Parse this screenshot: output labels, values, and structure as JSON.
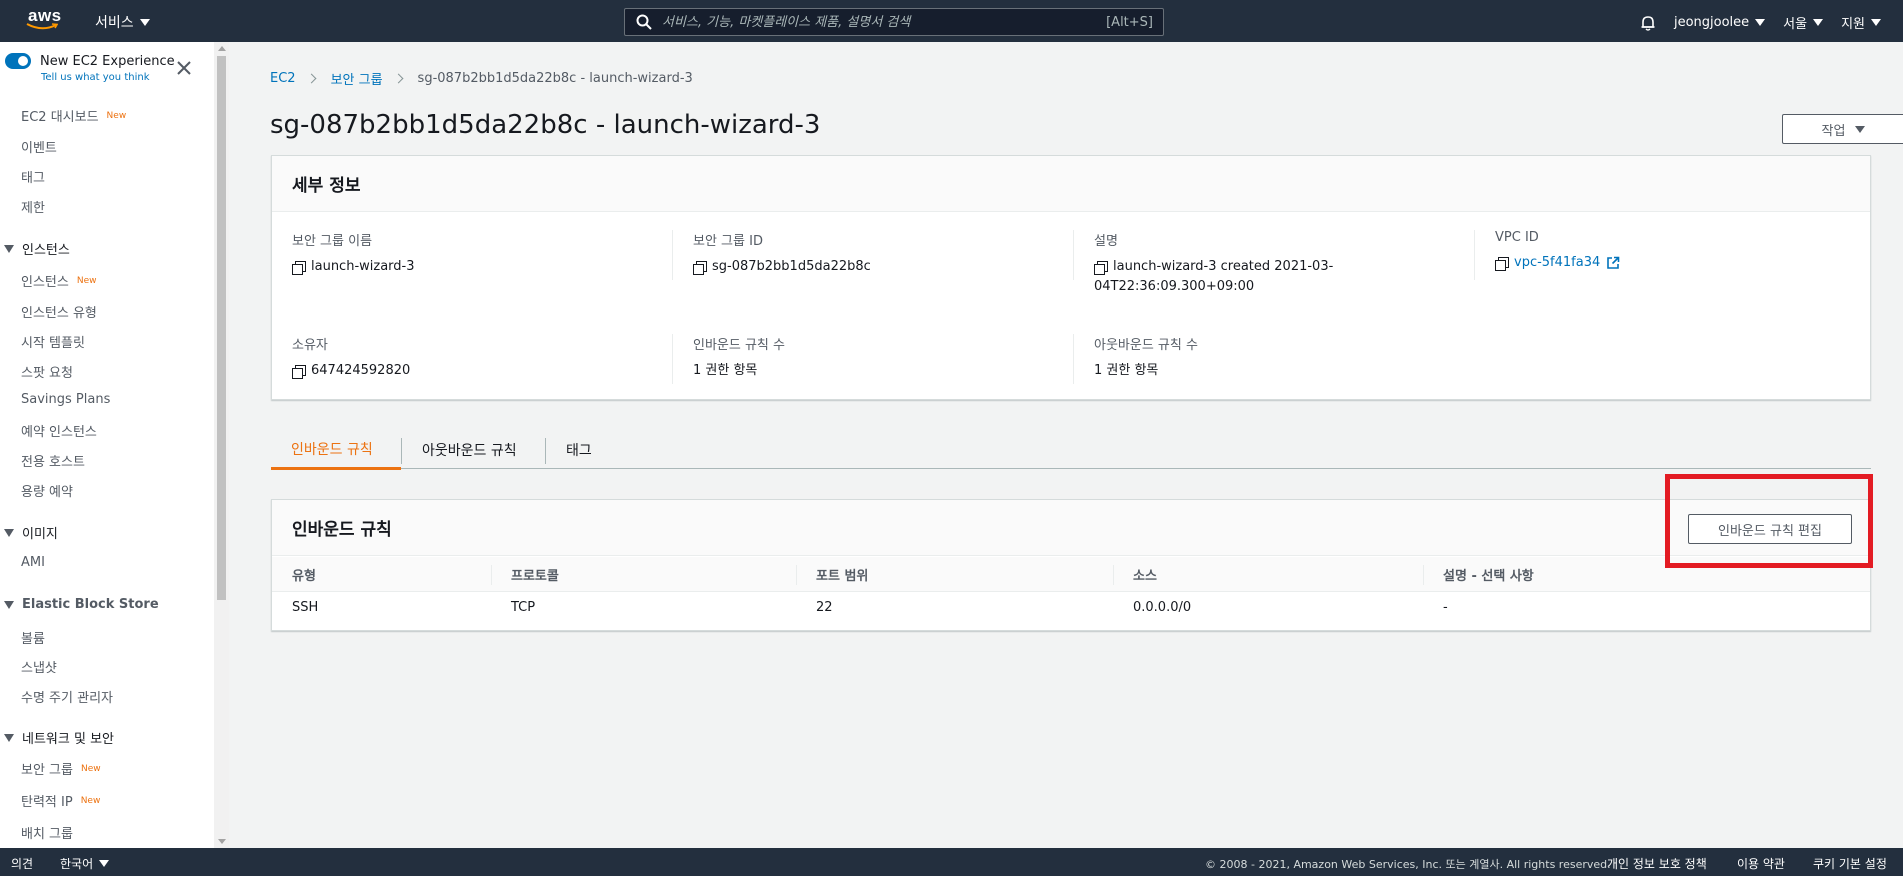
{
  "topbar": {
    "logo_text": "aws",
    "services_label": "서비스",
    "search_placeholder": "서비스, 기능, 마켓플레이스 제품, 설명서 검색",
    "search_shortcut": "[Alt+S]",
    "user": "jeongjoolee",
    "region": "서울",
    "support": "지원"
  },
  "sidebar": {
    "experience_title": "New EC2 Experience",
    "experience_sub": "Tell us what you think",
    "new_badge": "New",
    "items": [
      {
        "label": "EC2 대시보드",
        "new": true
      },
      {
        "label": "이벤트"
      },
      {
        "label": "태그"
      },
      {
        "label": "제한"
      }
    ],
    "sections": [
      {
        "title": "인스턴스",
        "items": [
          {
            "label": "인스턴스",
            "new": true
          },
          {
            "label": "인스턴스 유형"
          },
          {
            "label": "시작 템플릿"
          },
          {
            "label": "스팟 요청"
          },
          {
            "label": "Savings Plans"
          },
          {
            "label": "예약 인스턴스"
          },
          {
            "label": "전용 호스트"
          },
          {
            "label": "용량 예약"
          }
        ]
      },
      {
        "title": "이미지",
        "items": [
          {
            "label": "AMI"
          }
        ]
      },
      {
        "title": "Elastic Block Store",
        "items": [
          {
            "label": "볼륨"
          },
          {
            "label": "스냅샷"
          },
          {
            "label": "수명 주기 관리자"
          }
        ]
      },
      {
        "title": "네트워크 및 보안",
        "items": [
          {
            "label": "보안 그룹",
            "new": true
          },
          {
            "label": "탄력적 IP",
            "new": true
          },
          {
            "label": "배치 그룹"
          }
        ]
      }
    ]
  },
  "breadcrumb": [
    "EC2",
    "보안 그룹",
    "sg-087b2bb1d5da22b8c - launch-wizard-3"
  ],
  "page_title": "sg-087b2bb1d5da22b8c - launch-wizard-3",
  "actions_label": "작업",
  "details": {
    "header": "세부 정보",
    "fields": {
      "sg_name_label": "보안 그룹 이름",
      "sg_name": "launch-wizard-3",
      "sg_id_label": "보안 그룹 ID",
      "sg_id": "sg-087b2bb1d5da22b8c",
      "desc_label": "설명",
      "desc_line1": "launch-wizard-3 created 2021-03-",
      "desc_line2": "04T22:36:09.300+09:00",
      "vpc_label": "VPC ID",
      "vpc": "vpc-5f41fa34",
      "owner_label": "소유자",
      "owner": "647424592820",
      "inbound_count_label": "인바운드 규칙 수",
      "inbound_count": "1 권한 항목",
      "outbound_count_label": "아웃바운드 규칙 수",
      "outbound_count": "1 권한 항목"
    }
  },
  "tabs": [
    "인바운드 규칙",
    "아웃바운드 규칙",
    "태그"
  ],
  "inbound": {
    "header": "인바운드 규칙",
    "edit_button": "인바운드 규칙 편집",
    "columns": [
      "유형",
      "프로토콜",
      "포트 범위",
      "소스",
      "설명 - 선택 사항"
    ],
    "rows": [
      [
        "SSH",
        "TCP",
        "22",
        "0.0.0.0/0",
        "-"
      ]
    ]
  },
  "footer": {
    "feedback": "의견",
    "language": "한국어",
    "copyright": "© 2008 - 2021, Amazon Web Services, Inc. 또는 계열사. All rights reserved.",
    "privacy": "개인 정보 보호 정책",
    "terms": "이용 약관",
    "cookies": "쿠키 기본 설정"
  },
  "colors": {
    "nav_bg": "#232f3e",
    "link": "#0073bb",
    "accent": "#ec7211",
    "highlight": "#e31b23"
  }
}
